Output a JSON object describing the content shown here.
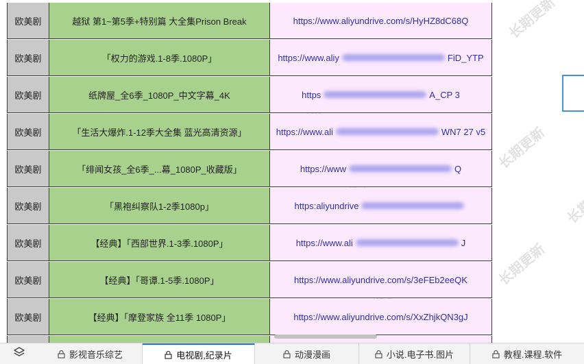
{
  "rows": [
    {
      "category": "欧美剧",
      "title": "越狱 第1~第5季+特别篇 大全集Prison Break",
      "link_start": "https://www.aliyundrive.com/s/HyHZ8dC68Q",
      "link_end": ""
    },
    {
      "category": "欧美剧",
      "title": "「权力的游戏.1-8季.1080P」",
      "link_start": "https://www.aliy",
      "link_end": "FiD_YTP"
    },
    {
      "category": "欧美剧",
      "title": "纸牌屋_全6季_1080P_中文字幕_4K",
      "link_start": "https",
      "link_end": "A_CP 3"
    },
    {
      "category": "欧美剧",
      "title": "「生活大爆炸.1-12季大全集 蓝光高清资源」",
      "link_start": "https://www.ali",
      "link_end": "WN7 27 v5"
    },
    {
      "category": "欧美剧",
      "title": "「绯闻女孩_全6季_...幕_1080P_收藏版」",
      "link_start": "https://www",
      "link_end": "Q"
    },
    {
      "category": "欧美剧",
      "title": "「黑袍纠察队1-2季1080p」",
      "link_start": "https:",
      "link_end": "aliyundrive"
    },
    {
      "category": "欧美剧",
      "title": "【经典】「西部世界.1-3季.1080P」",
      "link_start": "https://www.ali",
      "link_end": "J"
    },
    {
      "category": "欧美剧",
      "title": "【经典】「哥谭.1-5季.1080P」",
      "link_start": "https://www.aliyundrive.com/s/3eFEb2eeQK",
      "link_end": ""
    },
    {
      "category": "欧美剧",
      "title": "【经典】「摩登家族 全11季 1080P」",
      "link_start": "https://www.aliyundrive.com/s/XxZhjkQN3gJ",
      "link_end": ""
    }
  ],
  "tabs": [
    {
      "label": "影视音乐综艺",
      "active": false
    },
    {
      "label": "电视剧,纪录片",
      "active": true
    },
    {
      "label": "动漫漫画",
      "active": false
    },
    {
      "label": "小说.电子书.图片",
      "active": false
    },
    {
      "label": "教程.课程.软件",
      "active": false
    }
  ],
  "watermark": "长期更新",
  "colors": {
    "category_bg": "#c9c9c9",
    "title_bg": "#a9d18e",
    "link_bg": "#fde9fe",
    "link_text": "#2f2fa8",
    "active_tab_accent": "#1a73e8"
  },
  "icons": {
    "tab_toggle": "layers-icon",
    "tab": "lock-icon"
  }
}
